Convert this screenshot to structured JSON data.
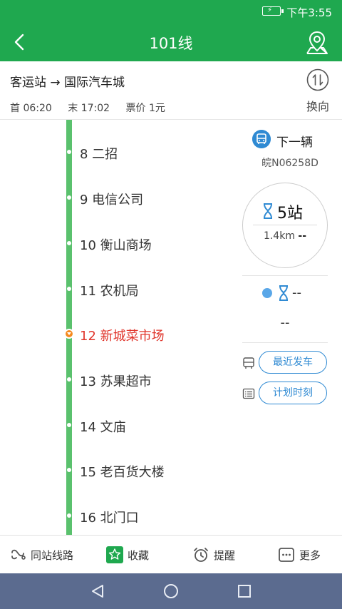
{
  "status_bar": {
    "time": "下午3:55",
    "battery_icon": "battery-charging-icon"
  },
  "app_bar": {
    "title": "101线",
    "back_icon": "back-arrow-icon",
    "map_icon": "map-pin-icon"
  },
  "route": {
    "direction": "客运站 → 国际汽车城",
    "first_bus": "首 06:20",
    "last_bus": "末 17:02",
    "fare": "票价 1元",
    "swap_label": "换向"
  },
  "stations": [
    {
      "label": "8 二招",
      "current": false
    },
    {
      "label": "9 电信公司",
      "current": false
    },
    {
      "label": "10 衡山商场",
      "current": false
    },
    {
      "label": "11 农机局",
      "current": false
    },
    {
      "label": "12 新城菜市场",
      "current": true
    },
    {
      "label": "13 苏果超市",
      "current": false
    },
    {
      "label": "14 文庙",
      "current": false
    },
    {
      "label": "15 老百货大楼",
      "current": false
    },
    {
      "label": "16 北门口",
      "current": false
    }
  ],
  "side": {
    "next_bus_label": "下一辆",
    "plate": "皖N06258D",
    "stops_away": "5站",
    "distance": "1.4km",
    "distance_suffix": "--",
    "second_eta": "--",
    "second_sub": "--",
    "recent_departure": "最近发车",
    "schedule": "计划时刻"
  },
  "bottom_bar": [
    {
      "label": "同站线路",
      "icon": "transfer-lines-icon"
    },
    {
      "label": "收藏",
      "icon": "star-icon"
    },
    {
      "label": "提醒",
      "icon": "alarm-clock-icon"
    },
    {
      "label": "更多",
      "icon": "more-icon"
    }
  ],
  "colors": {
    "primary": "#1fa84f",
    "line": "#5ac16d",
    "current_station": "#e0352b",
    "accent_blue": "#2f8ad3",
    "nav": "#5b6b8f"
  }
}
